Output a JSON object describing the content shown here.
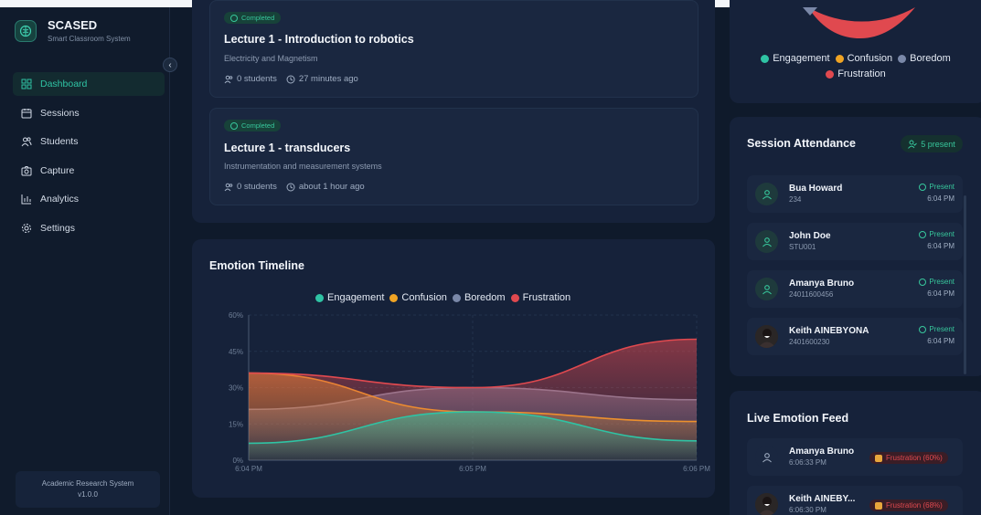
{
  "app": {
    "title": "SCASED",
    "subtitle": "Smart Classroom System",
    "footer_line1": "Academic Research System",
    "footer_line2": "v1.0.0"
  },
  "sidebar": {
    "items": [
      {
        "label": "Dashboard",
        "icon": "dashboard-icon",
        "active": true
      },
      {
        "label": "Sessions",
        "icon": "calendar-icon",
        "active": false
      },
      {
        "label": "Students",
        "icon": "users-icon",
        "active": false
      },
      {
        "label": "Capture",
        "icon": "camera-icon",
        "active": false
      },
      {
        "label": "Analytics",
        "icon": "bar-chart-icon",
        "active": false
      },
      {
        "label": "Settings",
        "icon": "gear-icon",
        "active": false
      }
    ]
  },
  "sessions": [
    {
      "status": "Completed",
      "title": "Lecture 1 - Introduction to robotics",
      "subject": "Electricity and Magnetism",
      "students": "0 students",
      "time": "27 minutes ago"
    },
    {
      "status": "Completed",
      "title": "Lecture 1 - transducers",
      "subject": "Instrumentation and measurement systems",
      "students": "0 students",
      "time": "about 1 hour ago"
    }
  ],
  "timeline": {
    "title": "Emotion Timeline"
  },
  "emotions": {
    "engagement": {
      "label": "Engagement",
      "color": "#2fc3a4"
    },
    "confusion": {
      "label": "Confusion",
      "color": "#f0a424"
    },
    "boredom": {
      "label": "Boredom",
      "color": "#7a88a8"
    },
    "frustration": {
      "label": "Frustration",
      "color": "#e0494f"
    }
  },
  "chart_data": {
    "type": "area",
    "title": "Emotion Timeline",
    "x": [
      "6:04 PM",
      "6:05 PM",
      "6:06 PM"
    ],
    "y_ticks": [
      "0%",
      "15%",
      "30%",
      "45%",
      "60%"
    ],
    "ylim": [
      0,
      60
    ],
    "grid": true,
    "legend": "top-center",
    "series": [
      {
        "name": "Engagement",
        "values": [
          7,
          20,
          8
        ]
      },
      {
        "name": "Confusion",
        "values": [
          36,
          20,
          16
        ]
      },
      {
        "name": "Boredom",
        "values": [
          21,
          30,
          25
        ]
      },
      {
        "name": "Frustration",
        "values": [
          36,
          30,
          50
        ]
      }
    ]
  },
  "attendance": {
    "title": "Session Attendance",
    "present_badge": "5 present",
    "rows": [
      {
        "name": "Bua Howard",
        "id": "234",
        "status": "Present",
        "time": "6:04 PM",
        "photo": false
      },
      {
        "name": "John Doe",
        "id": "STU001",
        "status": "Present",
        "time": "6:04 PM",
        "photo": false
      },
      {
        "name": "Amanya Bruno",
        "id": "24011600456",
        "status": "Present",
        "time": "6:04 PM",
        "photo": false
      },
      {
        "name": "Keith AINEBYONA",
        "id": "2401600230",
        "status": "Present",
        "time": "6:04 PM",
        "photo": true
      }
    ]
  },
  "feed": {
    "title": "Live Emotion Feed",
    "rows": [
      {
        "name": "Amanya Bruno",
        "time": "6:06:33 PM",
        "emotion": "Frustration (60%)",
        "photo": false
      },
      {
        "name": "Keith AINEBY...",
        "time": "6:06:30 PM",
        "emotion": "Frustration (68%)",
        "photo": true
      }
    ]
  }
}
